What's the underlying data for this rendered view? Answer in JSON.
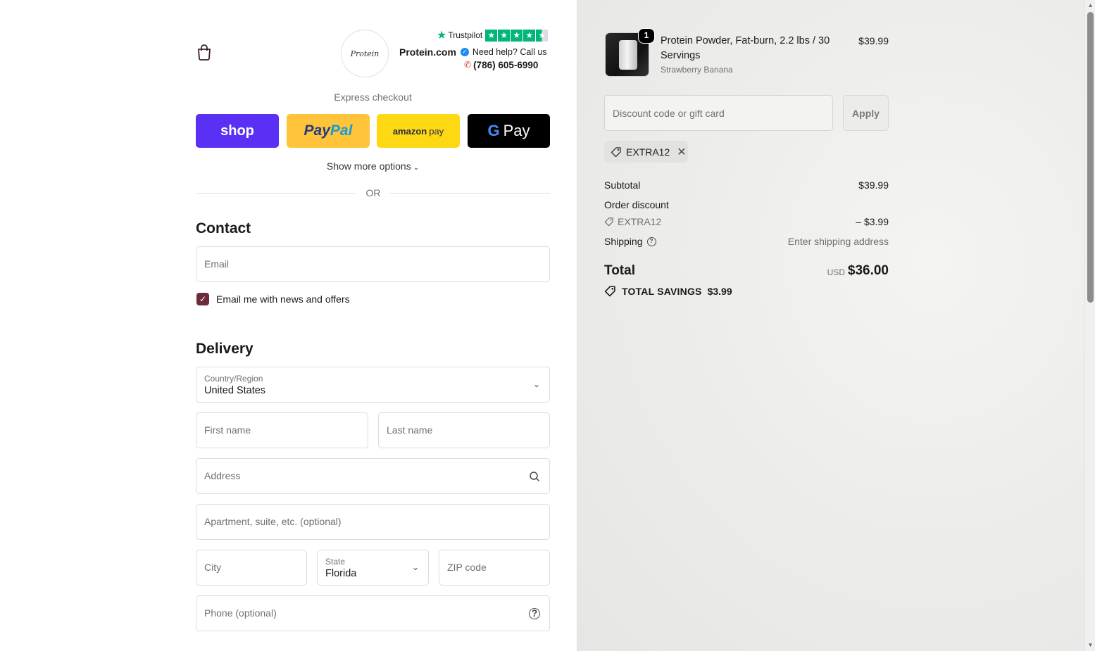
{
  "header": {
    "logo_text": "Protein",
    "trustpilot_label": "Trustpilot",
    "trustpilot_rating": 4.5,
    "brand_name": "Protein.com",
    "help_text": "Need help? Call us",
    "phone": "(786) 605-6990"
  },
  "express": {
    "title": "Express checkout",
    "shop_label": "shop",
    "paypal_label_1": "Pay",
    "paypal_label_2": "Pal",
    "amazon_label_1": "amazon",
    "amazon_label_2": "pay",
    "gpay_label_g": "G",
    "gpay_label": "Pay",
    "more_options": "Show more options",
    "or_text": "OR"
  },
  "contact": {
    "title": "Contact",
    "email_placeholder": "Email",
    "newsletter_label": "Email me with news and offers",
    "newsletter_checked": true
  },
  "delivery": {
    "title": "Delivery",
    "country_label": "Country/Region",
    "country_value": "United States",
    "first_name_placeholder": "First name",
    "last_name_placeholder": "Last name",
    "address_placeholder": "Address",
    "apartment_placeholder": "Apartment, suite, etc. (optional)",
    "city_placeholder": "City",
    "state_label": "State",
    "state_value": "Florida",
    "zip_placeholder": "ZIP code",
    "phone_placeholder": "Phone (optional)"
  },
  "summary": {
    "product": {
      "quantity": "1",
      "name": "Protein Powder, Fat-burn, 2.2 lbs / 30 Servings",
      "variant": "Strawberry Banana",
      "price": "$39.99"
    },
    "discount_placeholder": "Discount code or gift card",
    "apply_label": "Apply",
    "applied_code": "EXTRA12",
    "subtotal_label": "Subtotal",
    "subtotal_value": "$39.99",
    "order_discount_label": "Order discount",
    "discount_code": "EXTRA12",
    "discount_value": "– $3.99",
    "shipping_label": "Shipping",
    "shipping_value": "Enter shipping address",
    "total_label": "Total",
    "currency": "USD",
    "total_value": "$36.00",
    "savings_label": "TOTAL SAVINGS",
    "savings_value": "$3.99"
  },
  "colors": {
    "shop": "#5a31f4",
    "paypal": "#ffc439",
    "amazon": "#ffd814",
    "gpay": "#000000",
    "checkbox": "#6b2b3a",
    "trustpilot": "#00b67a"
  }
}
